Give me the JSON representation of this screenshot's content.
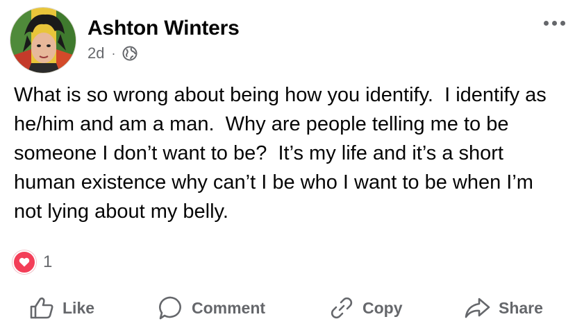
{
  "post": {
    "author": "Ashton Winters",
    "timestamp": "2d",
    "separator": "·",
    "audience_icon": "globe-icon",
    "body": "What is so wrong about being how you identify.  I identify as he/him and am a man.  Why are people telling me to be someone I don’t want to be?  It’s my life and it’s a short human existence why can’t I be who I want to be when I’m not lying about my belly."
  },
  "reactions": {
    "icon": "love-reaction-icon",
    "count": "1"
  },
  "actions": {
    "like": "Like",
    "comment": "Comment",
    "copy": "Copy",
    "share": "Share"
  },
  "colors": {
    "text": "#050505",
    "secondary": "#65676b",
    "love": "#f33e58"
  }
}
